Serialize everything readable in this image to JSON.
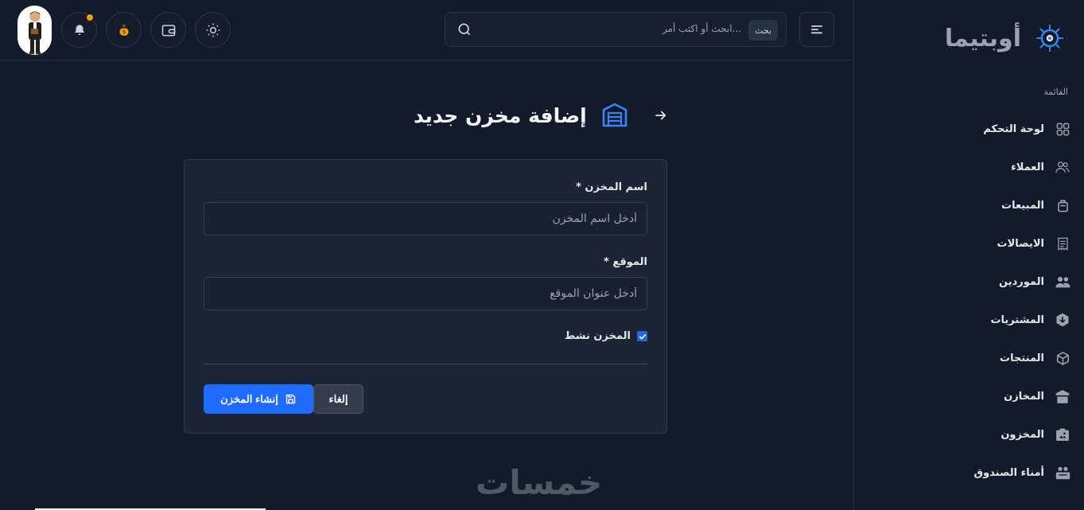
{
  "brand": {
    "name": "أوبتيما"
  },
  "sidebar": {
    "section_label": "القائمة",
    "items": [
      {
        "label": "لوحة التحكم",
        "icon": "grid-icon"
      },
      {
        "label": "العملاء",
        "icon": "users-icon"
      },
      {
        "label": "المبيعات",
        "icon": "bag-icon"
      },
      {
        "label": "الايصالات",
        "icon": "receipt-icon"
      },
      {
        "label": "الموردين",
        "icon": "people-icon"
      },
      {
        "label": "المشتريات",
        "icon": "box-down-icon"
      },
      {
        "label": "المنتجات",
        "icon": "cube-icon"
      },
      {
        "label": "المخازن",
        "icon": "warehouse-icon"
      },
      {
        "label": "المخزون",
        "icon": "inventory-icon"
      },
      {
        "label": "أمناء الصندوق",
        "icon": "cashier-icon"
      }
    ]
  },
  "topbar": {
    "search_badge": "بحث",
    "search_placeholder": "ابحث أو اكتب أمر..."
  },
  "page": {
    "title": "إضافة مخزن جديد"
  },
  "form": {
    "name_label": "اسم المخزن",
    "name_placeholder": "أدخل اسم المخزن",
    "location_label": "الموقع",
    "location_placeholder": "أدخل عنوان الموقع",
    "required_mark": "*",
    "active_label": "المخزن نشط",
    "active_checked": true,
    "create_label": "إنشاء المخزن",
    "cancel_label": "إلغاء"
  },
  "watermark": "خمسات",
  "colors": {
    "accent": "#1f6bff",
    "notification": "#f59e0b",
    "background": "#131b2b",
    "card": "#1c2536"
  }
}
